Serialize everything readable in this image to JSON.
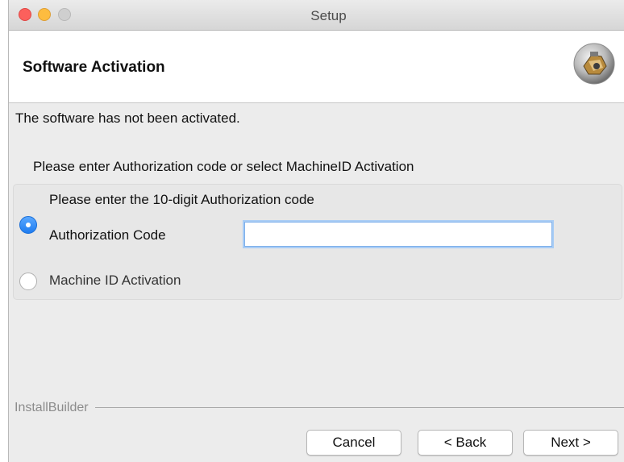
{
  "window": {
    "title": "Setup",
    "controls": {
      "close": "close-button",
      "minimize": "minimize-button",
      "zoom": "zoom-button"
    }
  },
  "header": {
    "title": "Software Activation",
    "logo_icon": "installer-logo-icon"
  },
  "body": {
    "status_text": "The software has not been activated.",
    "instruction": "Please enter Authorization code or select MachineID Activation",
    "options": {
      "hint": "Please enter the 10-digit Authorization code",
      "authorization_label": "Authorization Code",
      "authorization_value": "",
      "authorization_selected": true,
      "machine_id_label": "Machine ID Activation",
      "machine_id_selected": false
    }
  },
  "footer": {
    "brand": "InstallBuilder",
    "cancel_label": "Cancel",
    "back_label": "< Back",
    "next_label": "Next >"
  },
  "colors": {
    "accent": "#1f7cf0",
    "window_bg": "#ececec",
    "header_bg": "#ffffff"
  }
}
